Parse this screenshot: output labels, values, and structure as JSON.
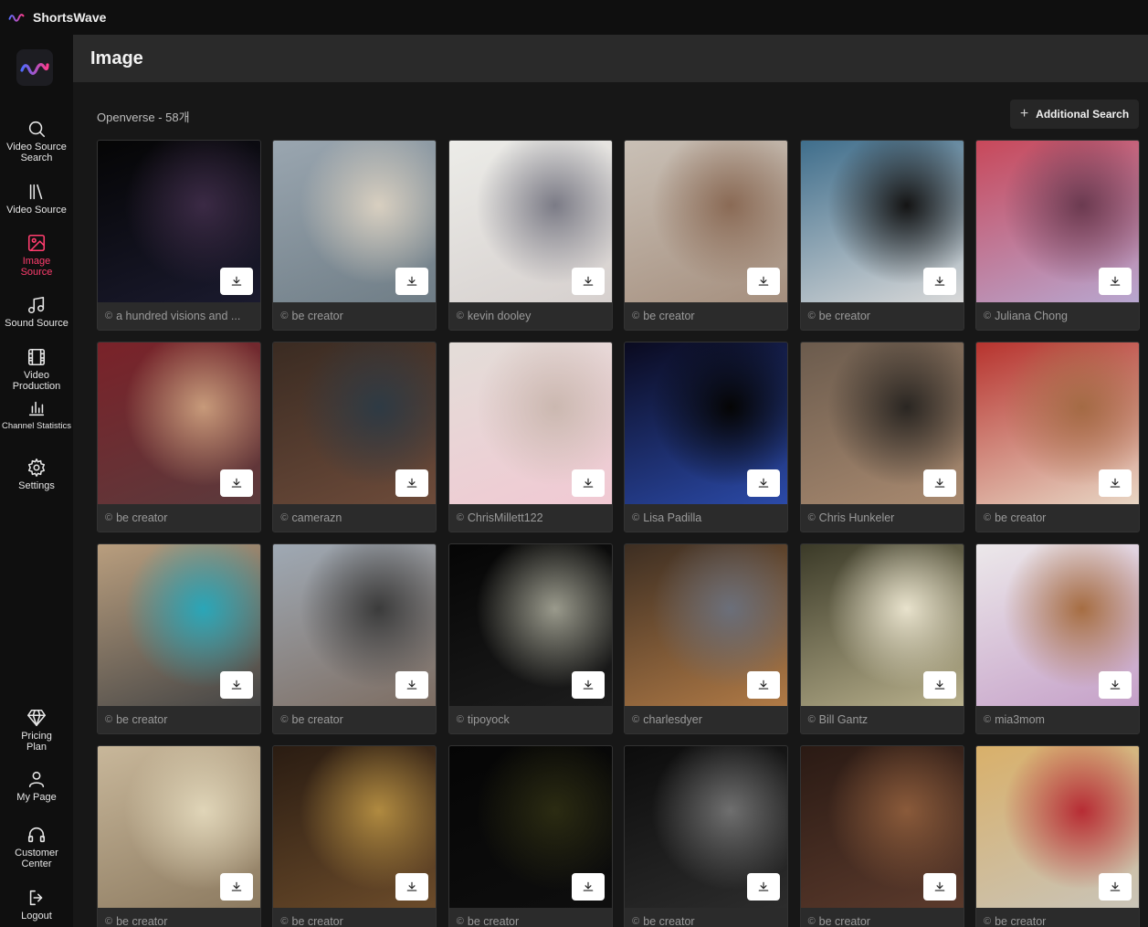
{
  "app": {
    "title": "ShortsWave"
  },
  "header": {
    "title": "Image"
  },
  "toolbar": {
    "result_label": "Openverse - 58개",
    "additional_search_label": "Additional Search"
  },
  "sidebar": {
    "items": [
      {
        "label": "Video Source\nSearch",
        "icon": "search-icon",
        "active": false
      },
      {
        "label": "Video Source",
        "icon": "library-icon",
        "active": false
      },
      {
        "label": "Image\nSource",
        "icon": "image-icon",
        "active": true
      },
      {
        "label": "Sound Source",
        "icon": "music-icon",
        "active": false
      },
      {
        "label": "Video Production",
        "icon": "film-icon",
        "active": false
      },
      {
        "label": "Channel Statistics",
        "icon": "bar-chart-icon",
        "active": false
      },
      {
        "label": "Settings",
        "icon": "gear-icon",
        "active": false
      }
    ],
    "bottom_items": [
      {
        "label": "Pricing\nPlan",
        "icon": "diamond-icon"
      },
      {
        "label": "My Page",
        "icon": "user-icon"
      },
      {
        "label": "Customer\nCenter",
        "icon": "headset-icon"
      },
      {
        "label": "Logout",
        "icon": "logout-icon"
      }
    ]
  },
  "colors": {
    "accent": "#ff3d6e",
    "background": "#171717",
    "header": "#2a2a2a",
    "card": "#2b2b2b"
  },
  "images": [
    {
      "credit": "a hundred visions and ...",
      "colors": [
        "#050505",
        "#1a1a2e",
        "#3b2a45"
      ]
    },
    {
      "credit": "be creator",
      "colors": [
        "#9aa6b0",
        "#6f7d86",
        "#d8cfc0"
      ]
    },
    {
      "credit": "kevin dooley",
      "colors": [
        "#ecece8",
        "#d6d0ce",
        "#7b7b86"
      ]
    },
    {
      "credit": "be creator",
      "colors": [
        "#c9c0b6",
        "#a58f7e",
        "#8a6a55"
      ]
    },
    {
      "credit": "be creator",
      "colors": [
        "#3f6e8c",
        "#d9d9d9",
        "#141414"
      ]
    },
    {
      "credit": "Juliana Chong",
      "colors": [
        "#c8485a",
        "#b8a7d0",
        "#6b3a50"
      ]
    },
    {
      "credit": "be creator",
      "colors": [
        "#7a2229",
        "#5b3a3c",
        "#c79a7a"
      ]
    },
    {
      "credit": "camerazn",
      "colors": [
        "#3a2b22",
        "#6d4b3a",
        "#2e3a44"
      ]
    },
    {
      "credit": "ChrisMillett122",
      "colors": [
        "#e3ddd8",
        "#f1c9d3",
        "#cbb8b0"
      ]
    },
    {
      "credit": "Lisa Padilla",
      "colors": [
        "#0a0a1f",
        "#2b4aa8",
        "#050505"
      ]
    },
    {
      "credit": "Chris Hunkeler",
      "colors": [
        "#6b5b4d",
        "#a98a70",
        "#2a2622"
      ]
    },
    {
      "credit": "be creator",
      "colors": [
        "#b7332e",
        "#e8d6c4",
        "#a46a44"
      ]
    },
    {
      "credit": "be creator",
      "colors": [
        "#b99e7e",
        "#444",
        "#2aa6b8"
      ]
    },
    {
      "credit": "be creator",
      "colors": [
        "#9fa9b4",
        "#7d6d62",
        "#3b3b3b"
      ]
    },
    {
      "credit": "tipoyock",
      "colors": [
        "#050505",
        "#1c1c1c",
        "#9a9a8c"
      ]
    },
    {
      "credit": "charlesdyer",
      "colors": [
        "#3d2e22",
        "#b07a46",
        "#6b6f7a"
      ]
    },
    {
      "credit": "Bill Gantz",
      "colors": [
        "#3b3a28",
        "#b8b08c",
        "#e8e2cc"
      ]
    },
    {
      "credit": "mia3mom",
      "colors": [
        "#ece8ea",
        "#c5a0c8",
        "#a66d42"
      ]
    },
    {
      "credit": "be creator",
      "colors": [
        "#c8b79a",
        "#8c7a60",
        "#e0d5b8"
      ]
    },
    {
      "credit": "be creator",
      "colors": [
        "#2a1c12",
        "#6b4b2a",
        "#b08a40"
      ]
    },
    {
      "credit": "be creator",
      "colors": [
        "#050505",
        "#0e0e0e",
        "#2b2b12"
      ]
    },
    {
      "credit": "be creator",
      "colors": [
        "#0c0c0c",
        "#2c2c2c",
        "#6f6f6f"
      ]
    },
    {
      "credit": "be creator",
      "colors": [
        "#2a1a14",
        "#5b3a2c",
        "#8a5a3a"
      ]
    },
    {
      "credit": "be creator",
      "colors": [
        "#d9b06a",
        "#c9c4b8",
        "#b72c34"
      ]
    }
  ]
}
